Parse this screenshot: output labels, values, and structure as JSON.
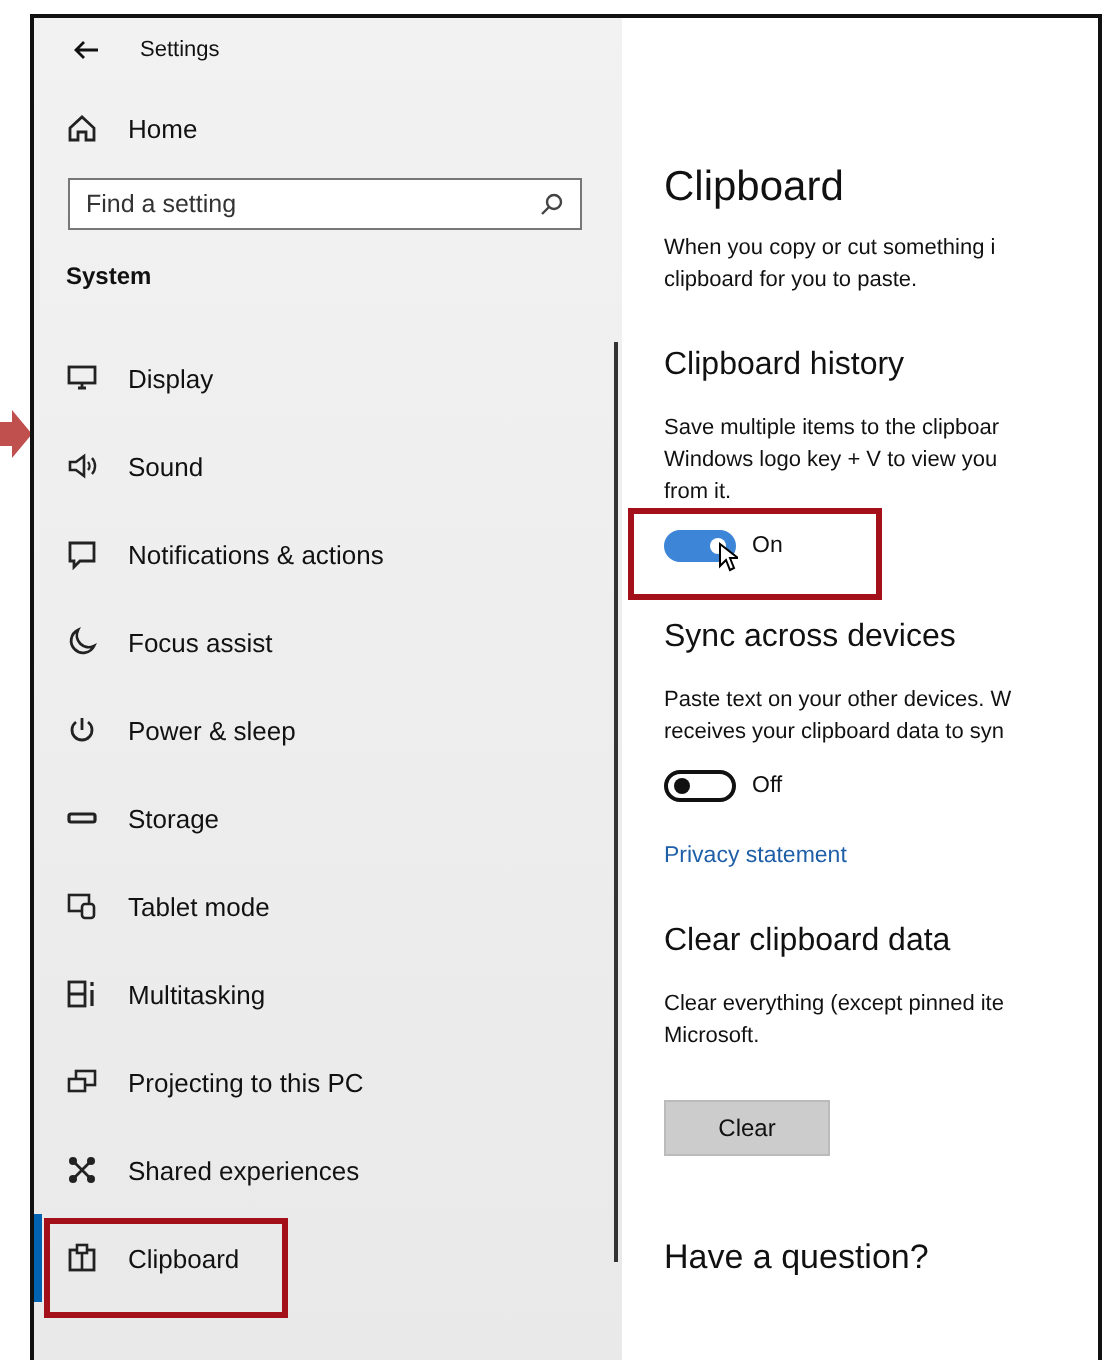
{
  "window": {
    "title": "Settings"
  },
  "sidebar": {
    "home": "Home",
    "search": {
      "placeholder": "Find a setting"
    },
    "section": "System",
    "items": [
      {
        "label": "Display",
        "selected": false,
        "annotated": false
      },
      {
        "label": "Sound",
        "selected": false,
        "annotated": false
      },
      {
        "label": "Notifications & actions",
        "selected": false,
        "annotated": false
      },
      {
        "label": "Focus assist",
        "selected": false,
        "annotated": false
      },
      {
        "label": "Power & sleep",
        "selected": false,
        "annotated": false
      },
      {
        "label": "Storage",
        "selected": false,
        "annotated": false
      },
      {
        "label": "Tablet mode",
        "selected": false,
        "annotated": false
      },
      {
        "label": "Multitasking",
        "selected": false,
        "annotated": false
      },
      {
        "label": "Projecting to this PC",
        "selected": false,
        "annotated": false
      },
      {
        "label": "Shared experiences",
        "selected": false,
        "annotated": false
      },
      {
        "label": "Clipboard",
        "selected": true,
        "annotated": true
      }
    ]
  },
  "page": {
    "title": "Clipboard",
    "intro": [
      "When you copy or cut something i",
      "clipboard for you to paste."
    ],
    "sections": [
      {
        "heading": "Clipboard history",
        "description": [
          "Save multiple items to the clipboar",
          "Windows logo key + V to view you",
          "from it."
        ],
        "toggle": {
          "on": true,
          "label": "On",
          "annotated": true
        }
      },
      {
        "heading": "Sync across devices",
        "description": [
          "Paste text on your other devices. W",
          "receives your clipboard data to syn"
        ],
        "toggle": {
          "on": false,
          "label": "Off"
        },
        "link": "Privacy statement"
      },
      {
        "heading": "Clear clipboard data",
        "description": [
          "Clear everything (except pinned ite",
          "Microsoft."
        ],
        "button": "Clear"
      },
      {
        "heading": "Have a question?"
      }
    ]
  }
}
